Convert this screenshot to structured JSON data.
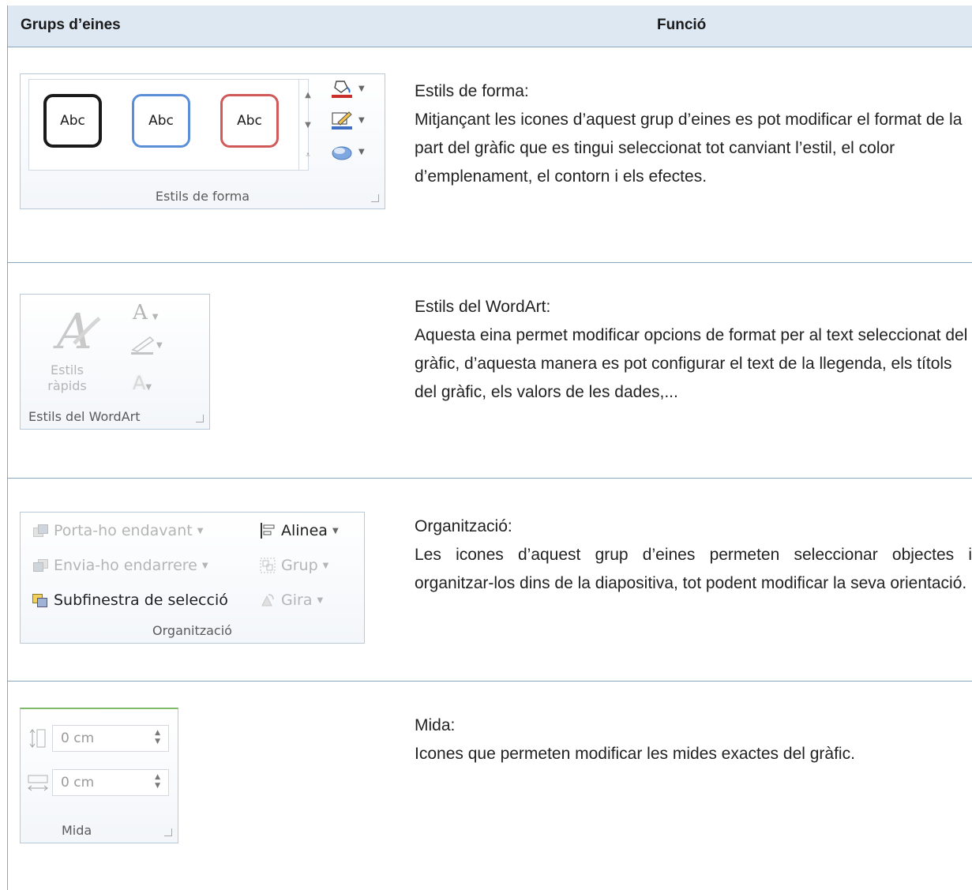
{
  "table": {
    "header": {
      "col1": "Grups d’eines",
      "col2": "Funció"
    },
    "rows": [
      {
        "panel_label": "Estils de forma",
        "gallery": [
          "Abc",
          "Abc",
          "Abc"
        ],
        "title": "Estils de forma:",
        "text": "Mitjançant les icones d’aquest grup d’eines es pot modificar el format de la part del gràfic que es tingui seleccionat tot canviant l’estil, el color d’emplenament, el contorn i els efectes."
      },
      {
        "panel_label": "Estils del WordArt",
        "quick_styles_line1": "Estils",
        "quick_styles_line2": "ràpids",
        "title": "Estils del WordArt:",
        "text": "Aquesta eina permet modificar opcions de format per al text seleccionat del gràfic, d’aquesta manera es pot configurar el text de la llegenda, els títols del gràfic, els valors de les dades,..."
      },
      {
        "panel_label": "Organització",
        "bring_forward": "Porta-ho endavant",
        "send_backward": "Envia-ho endarrere",
        "selection_pane": "Subfinestra de selecció",
        "align": "Alinea",
        "group": "Grup",
        "rotate": "Gira",
        "title": "Organització:",
        "text": "Les icones d’aquest grup d’eines permeten seleccionar objectes i organitzar-los dins de la diapositiva, tot podent modificar la seva orientació."
      },
      {
        "panel_label": "Mida",
        "height_value": "0 cm",
        "width_value": "0 cm",
        "title": "Mida:",
        "text": "Icones que permeten modificar les mides exactes del gràfic."
      }
    ]
  }
}
